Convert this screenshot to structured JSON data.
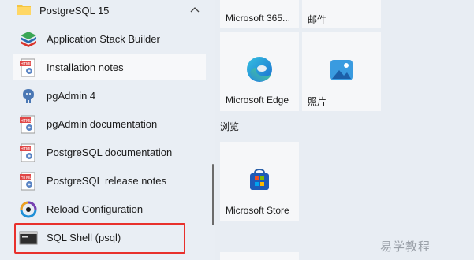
{
  "group": {
    "label": "PostgreSQL 15"
  },
  "apps": [
    {
      "label": "Application Stack Builder",
      "icon": "stack-builder-icon"
    },
    {
      "label": "Installation notes",
      "icon": "html-document-icon"
    },
    {
      "label": "pgAdmin 4",
      "icon": "pgadmin-elephant-icon"
    },
    {
      "label": "pgAdmin documentation",
      "icon": "html-document-icon"
    },
    {
      "label": "PostgreSQL documentation",
      "icon": "html-document-icon"
    },
    {
      "label": "PostgreSQL release notes",
      "icon": "html-document-icon"
    },
    {
      "label": "Reload Configuration",
      "icon": "reload-icon"
    },
    {
      "label": "SQL Shell (psql)",
      "icon": "terminal-icon"
    }
  ],
  "tiles": {
    "microsoft365": "Microsoft 365...",
    "mail": "邮件",
    "edge": "Microsoft Edge",
    "photos": "照片",
    "browse_section": "浏览",
    "store": "Microsoft Store"
  },
  "watermark": "易学教程",
  "colors": {
    "highlight": "#e8302c",
    "folder": "#f4c542"
  }
}
